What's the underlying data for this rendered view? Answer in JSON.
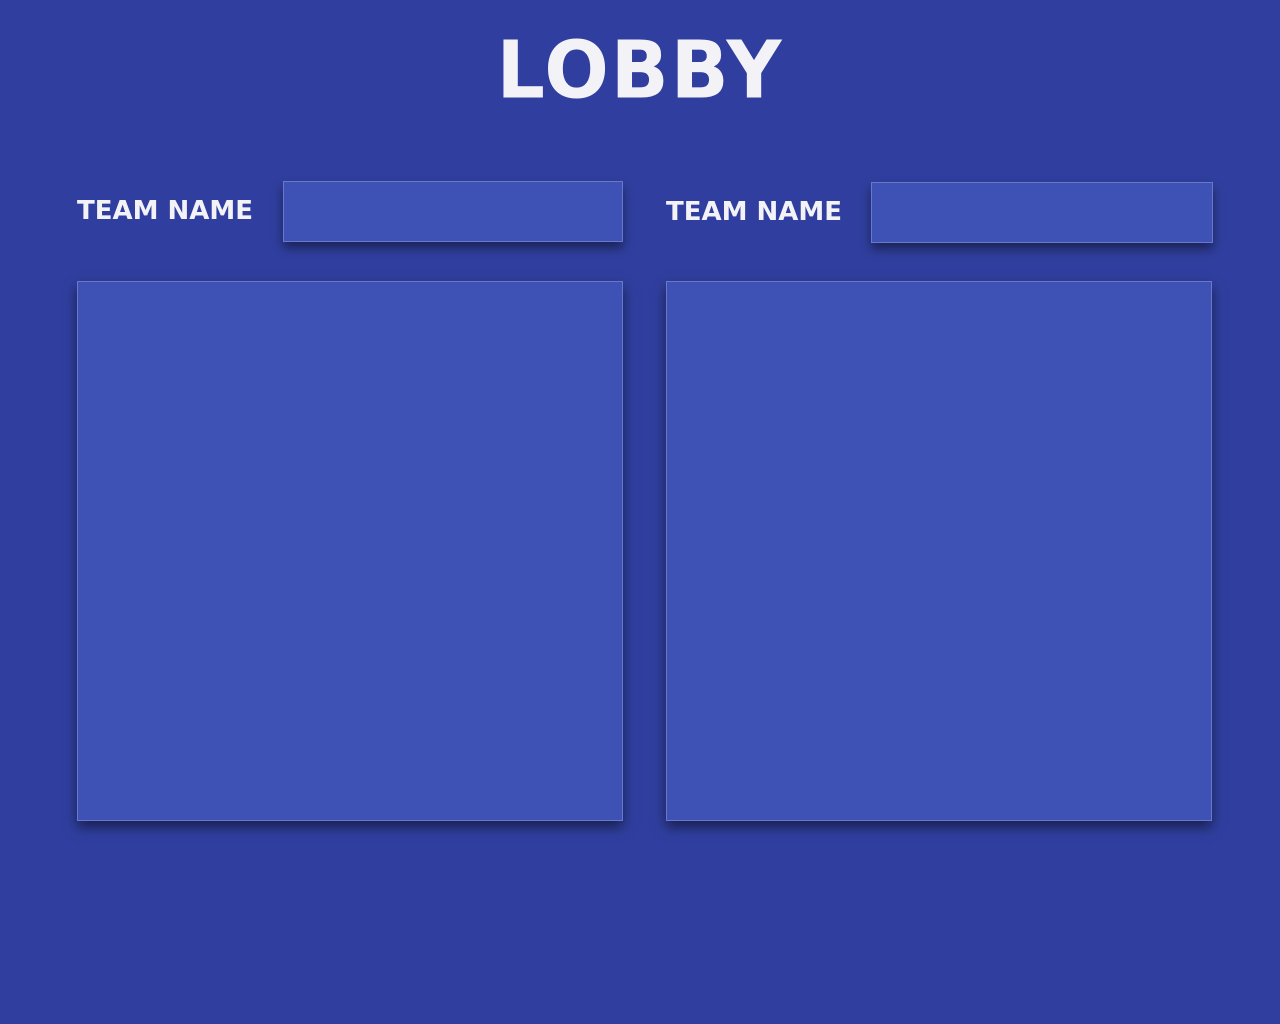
{
  "title": "LOBBY",
  "teams": [
    {
      "label": "TEAM NAME",
      "name_value": ""
    },
    {
      "label": "TEAM NAME",
      "name_value": ""
    }
  ],
  "colors": {
    "background": "#303f9f",
    "panel": "#3e51b5",
    "text": "#f3f3f7"
  }
}
